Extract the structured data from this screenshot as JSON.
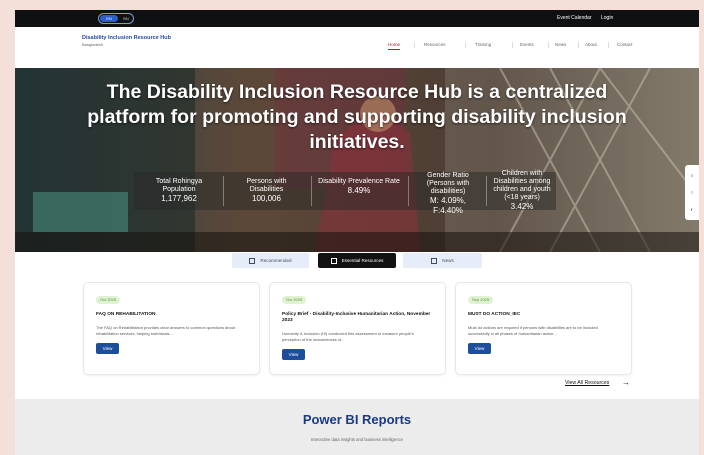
{
  "topbar": {
    "toggle": {
      "on_label": "EN",
      "off_label": "BN"
    },
    "links": [
      "Event Calendar",
      "Login"
    ]
  },
  "brand": {
    "title": "Disability Inclusion Resource Hub",
    "subtitle": "Bangladesh"
  },
  "nav": {
    "items": [
      "Home",
      "Resources",
      "Training",
      "Events",
      "News",
      "About",
      "Contact"
    ],
    "active_index": 0
  },
  "hero": {
    "title": "The Disability Inclusion Resource Hub is a centralized platform for promoting and supporting disability inclusion initiatives.",
    "stats": [
      {
        "label": "Total Rohingya Population",
        "value": "1,177,962"
      },
      {
        "label": "Persons with Disabilities",
        "value": "100,006"
      },
      {
        "label": "Disability Prevalence Rate",
        "value": "8.49%"
      },
      {
        "label": "Gender Ratio (Persons with disabilities)",
        "value": "M: 4.09%, F:4.40%"
      },
      {
        "label": "Children with Disabilities among children and youth (<18 years)",
        "value": "3.42%"
      }
    ],
    "side_icons": [
      "search-icon",
      "settings-icon",
      "contrast-icon"
    ]
  },
  "tabs": [
    {
      "label": "Recommended",
      "active": false
    },
    {
      "label": "Essential Resources",
      "active": true
    },
    {
      "label": "News",
      "active": false
    }
  ],
  "cards": [
    {
      "badge": "Oct 2025",
      "title": "FAQ ON REHABILITATION",
      "description": "The FAQ on Rehabilitation provides clear answers to common questions about rehabilitation services, helping individuals...",
      "button": "View"
    },
    {
      "badge": "Oct 2025",
      "title": "Policy Brief - Disability-Inclusive Humanitarian Action, November 2023",
      "description": "Humanity & Inclusion (HI) conducted this assessment to measure people's perception of the inclusiveness of...",
      "button": "View"
    },
    {
      "badge": "Sep 2025",
      "title": "MUST DO ACTION_IEC",
      "description": "Must do actions are required if persons with disabilities are to be included successfully in all phases of humanitarian action...",
      "button": "View"
    }
  ],
  "view_all": "View All Resources",
  "reports": {
    "title": "Power BI Reports",
    "subtitle": "Interactive data insights and business intelligence"
  },
  "colors": {
    "accent_blue": "#1d4e9b",
    "brand_blue": "#2549a4",
    "active_nav": "#a91d2a",
    "badge_green": "#dff3d3",
    "page_bg": "#f4dfd9"
  }
}
